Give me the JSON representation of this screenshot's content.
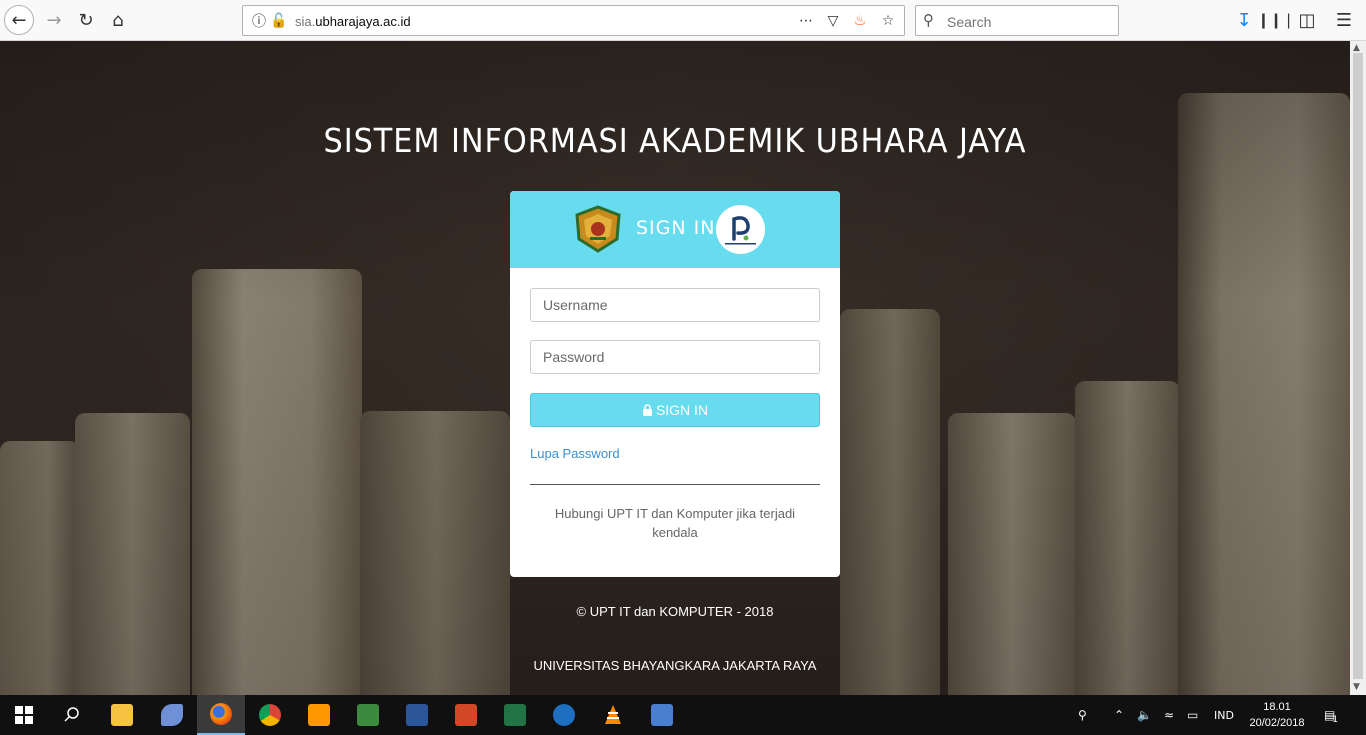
{
  "browser": {
    "url_prefix": "sia.",
    "url_host": "ubharajaya.ac.id",
    "search_placeholder": "Search"
  },
  "page": {
    "title": "SISTEM INFORMASI AKADEMIK UBHARA JAYA",
    "card_title": "SIGN IN",
    "username_placeholder": "Username",
    "password_placeholder": "Password",
    "signin_button": "SIGN IN",
    "forgot_password": "Lupa Password",
    "help_text": "Hubungi UPT IT dan Komputer jika terjadi kendala",
    "copyright": "© UPT IT dan KOMPUTER - 2018",
    "university": "UNIVERSITAS BHAYANGKARA JAKARTA RAYA"
  },
  "taskbar": {
    "apps": [
      "start",
      "search",
      "file-explorer",
      "dolphin",
      "firefox",
      "chrome",
      "sublime-text",
      "network-app",
      "word",
      "powerpoint",
      "excel",
      "browser-globe",
      "vlc",
      "remote-desktop"
    ],
    "language": "IND",
    "time": "18.01",
    "date": "20/02/2018",
    "notification_count": "1"
  }
}
